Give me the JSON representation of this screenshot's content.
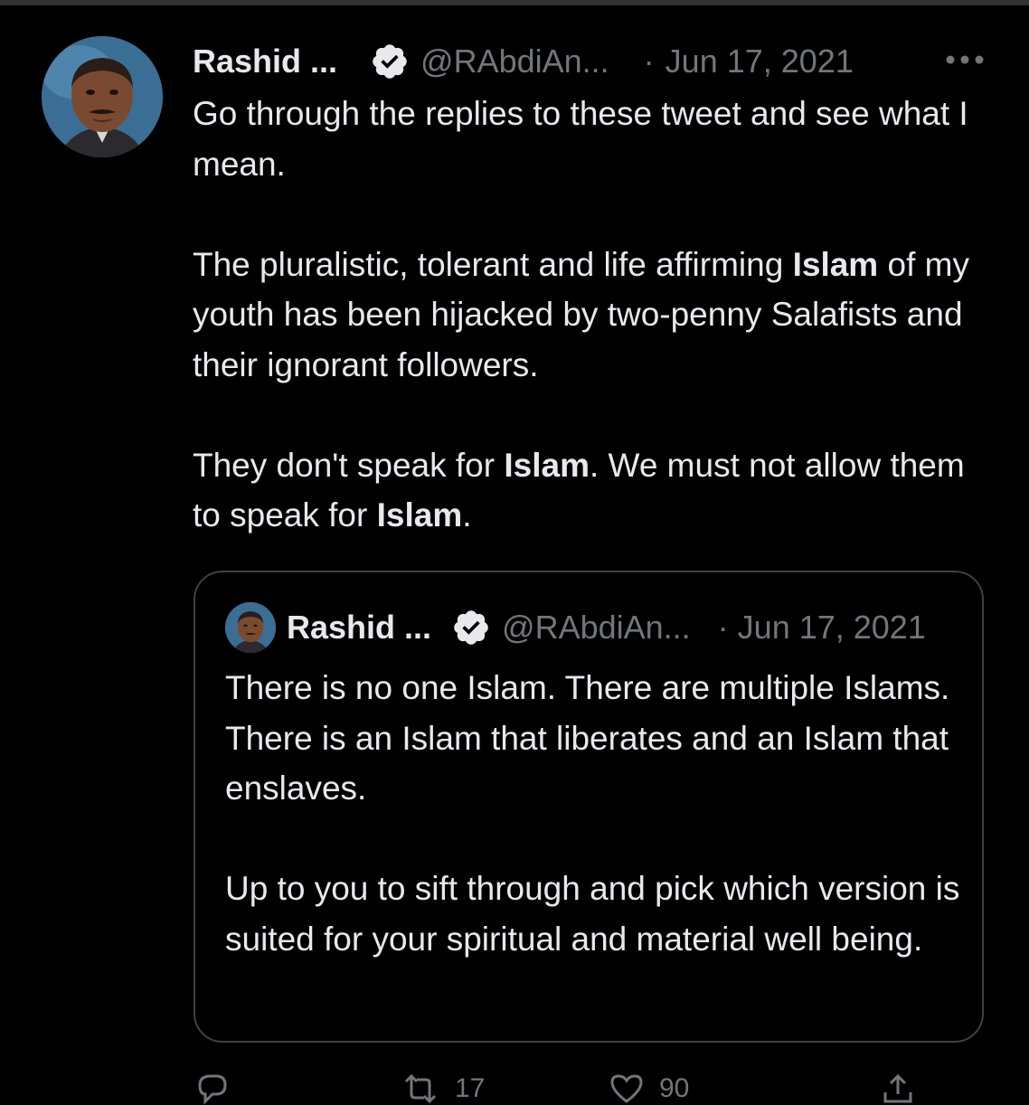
{
  "tweet": {
    "author_name": "Rashid ...",
    "handle": "@RAbdiAn...",
    "separator": "·",
    "date": "Jun 17, 2021",
    "more_icon": "ellipsis-horizontal-icon",
    "avatar_icon": "profile-photo",
    "paragraphs": [
      {
        "segments": [
          {
            "text": "Go through the replies to these tweet and see what I mean.",
            "bold": false
          }
        ]
      },
      {
        "segments": [
          {
            "text": "The pluralistic, tolerant and life affirming ",
            "bold": false
          },
          {
            "text": "Islam",
            "bold": true
          },
          {
            "text": " of my youth has been hijacked by two-penny Salafists and their ignorant followers.",
            "bold": false
          }
        ]
      },
      {
        "segments": [
          {
            "text": "They don't speak for ",
            "bold": false
          },
          {
            "text": "Islam",
            "bold": true
          },
          {
            "text": ". We must not allow them to speak for ",
            "bold": false
          },
          {
            "text": "Islam",
            "bold": true
          },
          {
            "text": ".",
            "bold": false
          }
        ]
      }
    ]
  },
  "quote": {
    "author_name": "Rashid ...",
    "handle": "@RAbdiAn...",
    "separator": "·",
    "date": "Jun 17, 2021",
    "paragraphs": [
      "There is no one Islam. There are multiple Islams. There is an Islam that liberates and an Islam that enslaves.",
      "Up to you to sift through and pick which version is suited for your spiritual and material well being."
    ]
  },
  "actions": {
    "reply_icon": "reply-icon",
    "retweet_icon": "retweet-icon",
    "like_icon": "heart-icon",
    "share_icon": "share-icon",
    "retweet_count": "17",
    "like_count": "90"
  },
  "colors": {
    "background": "#000000",
    "text_primary": "#e7e9ea",
    "text_secondary": "#71767b",
    "border": "#3e4144",
    "badge": "#e7e9ea"
  }
}
